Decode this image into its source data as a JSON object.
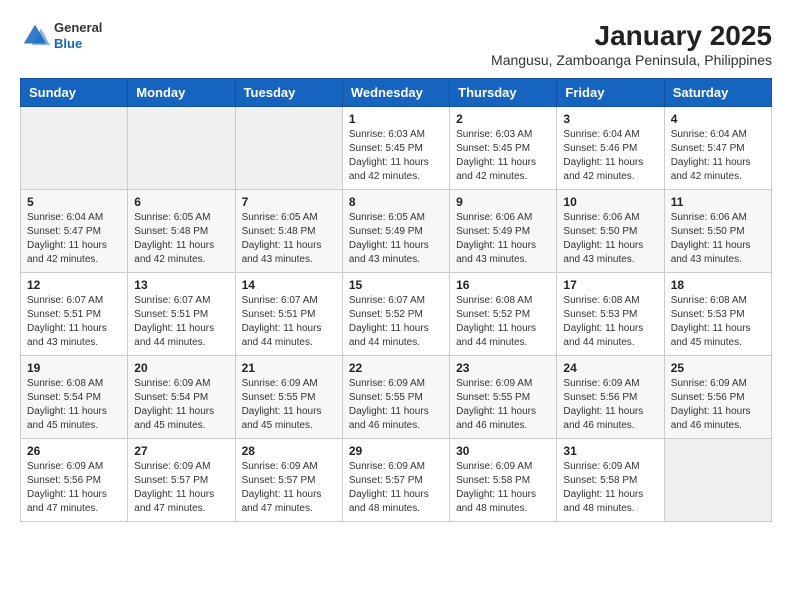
{
  "header": {
    "logo": {
      "general": "General",
      "blue": "Blue"
    },
    "title": "January 2025",
    "subtitle": "Mangusu, Zamboanga Peninsula, Philippines"
  },
  "calendar": {
    "days_of_week": [
      "Sunday",
      "Monday",
      "Tuesday",
      "Wednesday",
      "Thursday",
      "Friday",
      "Saturday"
    ],
    "weeks": [
      [
        {
          "day": "",
          "info": ""
        },
        {
          "day": "",
          "info": ""
        },
        {
          "day": "",
          "info": ""
        },
        {
          "day": "1",
          "info": "Sunrise: 6:03 AM\nSunset: 5:45 PM\nDaylight: 11 hours\nand 42 minutes."
        },
        {
          "day": "2",
          "info": "Sunrise: 6:03 AM\nSunset: 5:45 PM\nDaylight: 11 hours\nand 42 minutes."
        },
        {
          "day": "3",
          "info": "Sunrise: 6:04 AM\nSunset: 5:46 PM\nDaylight: 11 hours\nand 42 minutes."
        },
        {
          "day": "4",
          "info": "Sunrise: 6:04 AM\nSunset: 5:47 PM\nDaylight: 11 hours\nand 42 minutes."
        }
      ],
      [
        {
          "day": "5",
          "info": "Sunrise: 6:04 AM\nSunset: 5:47 PM\nDaylight: 11 hours\nand 42 minutes."
        },
        {
          "day": "6",
          "info": "Sunrise: 6:05 AM\nSunset: 5:48 PM\nDaylight: 11 hours\nand 42 minutes."
        },
        {
          "day": "7",
          "info": "Sunrise: 6:05 AM\nSunset: 5:48 PM\nDaylight: 11 hours\nand 43 minutes."
        },
        {
          "day": "8",
          "info": "Sunrise: 6:05 AM\nSunset: 5:49 PM\nDaylight: 11 hours\nand 43 minutes."
        },
        {
          "day": "9",
          "info": "Sunrise: 6:06 AM\nSunset: 5:49 PM\nDaylight: 11 hours\nand 43 minutes."
        },
        {
          "day": "10",
          "info": "Sunrise: 6:06 AM\nSunset: 5:50 PM\nDaylight: 11 hours\nand 43 minutes."
        },
        {
          "day": "11",
          "info": "Sunrise: 6:06 AM\nSunset: 5:50 PM\nDaylight: 11 hours\nand 43 minutes."
        }
      ],
      [
        {
          "day": "12",
          "info": "Sunrise: 6:07 AM\nSunset: 5:51 PM\nDaylight: 11 hours\nand 43 minutes."
        },
        {
          "day": "13",
          "info": "Sunrise: 6:07 AM\nSunset: 5:51 PM\nDaylight: 11 hours\nand 44 minutes."
        },
        {
          "day": "14",
          "info": "Sunrise: 6:07 AM\nSunset: 5:51 PM\nDaylight: 11 hours\nand 44 minutes."
        },
        {
          "day": "15",
          "info": "Sunrise: 6:07 AM\nSunset: 5:52 PM\nDaylight: 11 hours\nand 44 minutes."
        },
        {
          "day": "16",
          "info": "Sunrise: 6:08 AM\nSunset: 5:52 PM\nDaylight: 11 hours\nand 44 minutes."
        },
        {
          "day": "17",
          "info": "Sunrise: 6:08 AM\nSunset: 5:53 PM\nDaylight: 11 hours\nand 44 minutes."
        },
        {
          "day": "18",
          "info": "Sunrise: 6:08 AM\nSunset: 5:53 PM\nDaylight: 11 hours\nand 45 minutes."
        }
      ],
      [
        {
          "day": "19",
          "info": "Sunrise: 6:08 AM\nSunset: 5:54 PM\nDaylight: 11 hours\nand 45 minutes."
        },
        {
          "day": "20",
          "info": "Sunrise: 6:09 AM\nSunset: 5:54 PM\nDaylight: 11 hours\nand 45 minutes."
        },
        {
          "day": "21",
          "info": "Sunrise: 6:09 AM\nSunset: 5:55 PM\nDaylight: 11 hours\nand 45 minutes."
        },
        {
          "day": "22",
          "info": "Sunrise: 6:09 AM\nSunset: 5:55 PM\nDaylight: 11 hours\nand 46 minutes."
        },
        {
          "day": "23",
          "info": "Sunrise: 6:09 AM\nSunset: 5:55 PM\nDaylight: 11 hours\nand 46 minutes."
        },
        {
          "day": "24",
          "info": "Sunrise: 6:09 AM\nSunset: 5:56 PM\nDaylight: 11 hours\nand 46 minutes."
        },
        {
          "day": "25",
          "info": "Sunrise: 6:09 AM\nSunset: 5:56 PM\nDaylight: 11 hours\nand 46 minutes."
        }
      ],
      [
        {
          "day": "26",
          "info": "Sunrise: 6:09 AM\nSunset: 5:56 PM\nDaylight: 11 hours\nand 47 minutes."
        },
        {
          "day": "27",
          "info": "Sunrise: 6:09 AM\nSunset: 5:57 PM\nDaylight: 11 hours\nand 47 minutes."
        },
        {
          "day": "28",
          "info": "Sunrise: 6:09 AM\nSunset: 5:57 PM\nDaylight: 11 hours\nand 47 minutes."
        },
        {
          "day": "29",
          "info": "Sunrise: 6:09 AM\nSunset: 5:57 PM\nDaylight: 11 hours\nand 48 minutes."
        },
        {
          "day": "30",
          "info": "Sunrise: 6:09 AM\nSunset: 5:58 PM\nDaylight: 11 hours\nand 48 minutes."
        },
        {
          "day": "31",
          "info": "Sunrise: 6:09 AM\nSunset: 5:58 PM\nDaylight: 11 hours\nand 48 minutes."
        },
        {
          "day": "",
          "info": ""
        }
      ]
    ]
  }
}
